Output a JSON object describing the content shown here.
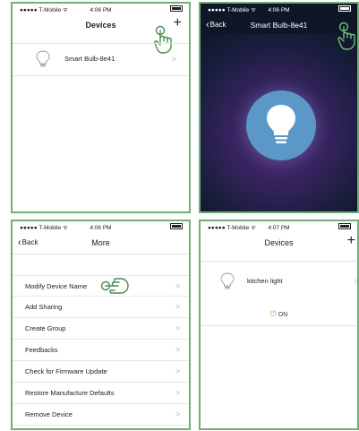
{
  "panel1": {
    "status": {
      "carrier": "●●●●● T-Mobile ᯤ",
      "time": "4:06 PM"
    },
    "title": "Devices",
    "add_label": "+",
    "device": {
      "name": "Smart Bulb-8e41",
      "arrow": ">"
    }
  },
  "panel2": {
    "status": {
      "carrier": "●●●●● T-Mobile ᯤ",
      "time": "4:06 PM"
    },
    "back_label": "Back",
    "title": "Smart Bulb-8e41"
  },
  "panel3": {
    "status": {
      "carrier": "●●●●● T-Mobile ᯤ",
      "time": "4:06 PM"
    },
    "back_label": "Back",
    "title": "More",
    "items": [
      {
        "label": "Modify Device Name",
        "arrow": ">"
      },
      {
        "label": "Add Sharing",
        "arrow": ">"
      },
      {
        "label": "Create Group",
        "arrow": ">"
      },
      {
        "label": "Feedbacks",
        "arrow": ">"
      },
      {
        "label": "Check for Firmware Update",
        "arrow": ">"
      },
      {
        "label": "Restore Manufacture Defaults",
        "arrow": ">"
      },
      {
        "label": "Remove Device",
        "arrow": ">"
      }
    ]
  },
  "panel4": {
    "status": {
      "carrier": "●●●●● T-Mobile ᯤ",
      "time": "4:07 PM"
    },
    "title": "Devices",
    "add_label": "+",
    "device": {
      "name": "kitchen light",
      "arrow": ">"
    },
    "on_label": "ON"
  },
  "colors": {
    "frame": "#6fae78",
    "accent_orange": "#f08a24",
    "bulb_blue": "#5b98c8"
  }
}
